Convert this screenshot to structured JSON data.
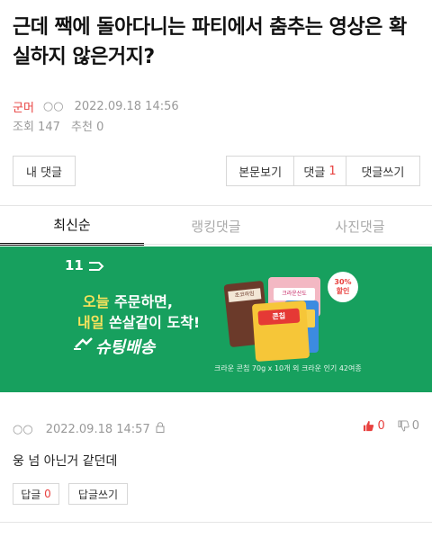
{
  "post": {
    "title": "근데 짹에 돌아다니는 파티에서 춤추는 영상은 확실하지 않은거지?",
    "author": "군머",
    "author_ip": "○○",
    "date": "2022.09.18 14:56",
    "views": "조회 147",
    "likes": "추천 0"
  },
  "buttons": {
    "my_comments": "내 댓글",
    "body_view": "본문보기",
    "comments_label": "댓글",
    "comments_count": "1",
    "write_comment": "댓글쓰기"
  },
  "tabs": [
    {
      "label": "최신순",
      "active": true
    },
    {
      "label": "랭킹댓글",
      "active": false
    },
    {
      "label": "사진댓글",
      "active": false
    }
  ],
  "banner": {
    "logo": "11",
    "line1_a": "오늘",
    "line1_b": " 주문하면,",
    "line2_a": "내일",
    "line2_b": " 쏜살같이 도착!",
    "brand": "슈팅배송",
    "sale_pct": "30%",
    "sale_text": "할인",
    "caption": "크라운 콘칩 70g x 10개 외 크라운 인기 42여종",
    "prod1_label": "초코하임",
    "prod2_label": "크라운산도",
    "prod3_label": "콘칩",
    "accent_color": "#17a05e",
    "highlight_color": "#f6e25c"
  },
  "comment": {
    "author": "○○",
    "date": "2022.09.18 14:57",
    "upvotes": "0",
    "downvotes": "0",
    "text": "웅 넘 아닌거 같던데",
    "reply_label": "답글",
    "reply_count": "0",
    "write_reply": "답글쓰기"
  }
}
